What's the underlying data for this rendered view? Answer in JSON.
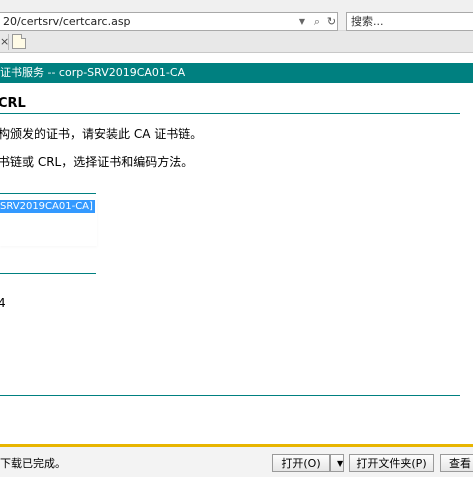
{
  "browser": {
    "address": "20/certsrv/certcarc.asp",
    "search_placeholder": "搜索...",
    "icons": {
      "refresh": "refresh-icon",
      "search": "search-icon",
      "tab_close": "close-icon",
      "new_tab": "new-tab-icon"
    }
  },
  "page": {
    "header": "证书服务  --  corp-SRV2019CA01-CA",
    "title": "CRL",
    "para1": "构颁发的证书，请安装此 CA 证书链。",
    "para2": "书链或 CRL，选择证书和编码方法。",
    "ca_item": "SRV2019CA01-CA]",
    "stray_value": "4"
  },
  "download_bar": {
    "message": "下载已完成。",
    "open_label": "打开(O)",
    "open_dropdown": "▼",
    "open_folder_label": "打开文件夹(P)",
    "view_label": "查看"
  },
  "colors": {
    "header": "#008080",
    "selection": "#3399ff",
    "download_bar_accent": "#e8b500"
  }
}
